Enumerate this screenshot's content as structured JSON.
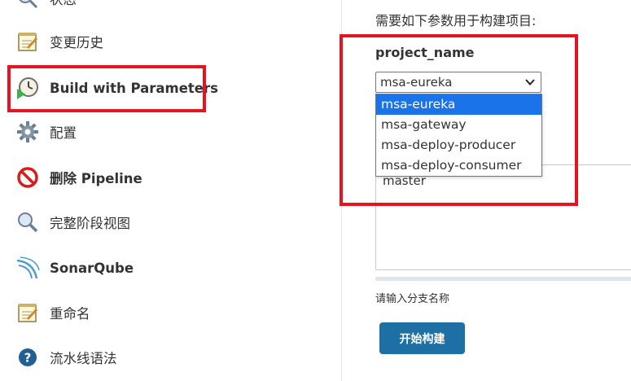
{
  "sidebar": {
    "items": [
      {
        "label": "状态",
        "icon": "status-icon"
      },
      {
        "label": "变更历史",
        "icon": "notepad-icon"
      },
      {
        "label": "Build with Parameters",
        "icon": "build-clock-icon"
      },
      {
        "label": "配置",
        "icon": "gear-icon"
      },
      {
        "label": "删除 Pipeline",
        "icon": "no-entry-icon"
      },
      {
        "label": "完整阶段视图",
        "icon": "magnifier-icon"
      },
      {
        "label": "SonarQube",
        "icon": "sonarqube-icon"
      },
      {
        "label": "重命名",
        "icon": "notepad-icon"
      },
      {
        "label": "流水线语法",
        "icon": "help-icon"
      }
    ]
  },
  "main": {
    "intro": "需要如下参数用于构建项目:",
    "param_name": "project_name",
    "select": {
      "value": "msa-eureka",
      "options": [
        "msa-eureka",
        "msa-gateway",
        "msa-deploy-producer",
        "msa-deploy-consumer"
      ]
    },
    "branch_value": "master",
    "branch_hint": "请输入分支名称",
    "build_button": "开始构建"
  },
  "colors": {
    "highlight": "#e5141f",
    "button": "#1e6fa4",
    "selected_option": "#1a73e8"
  }
}
